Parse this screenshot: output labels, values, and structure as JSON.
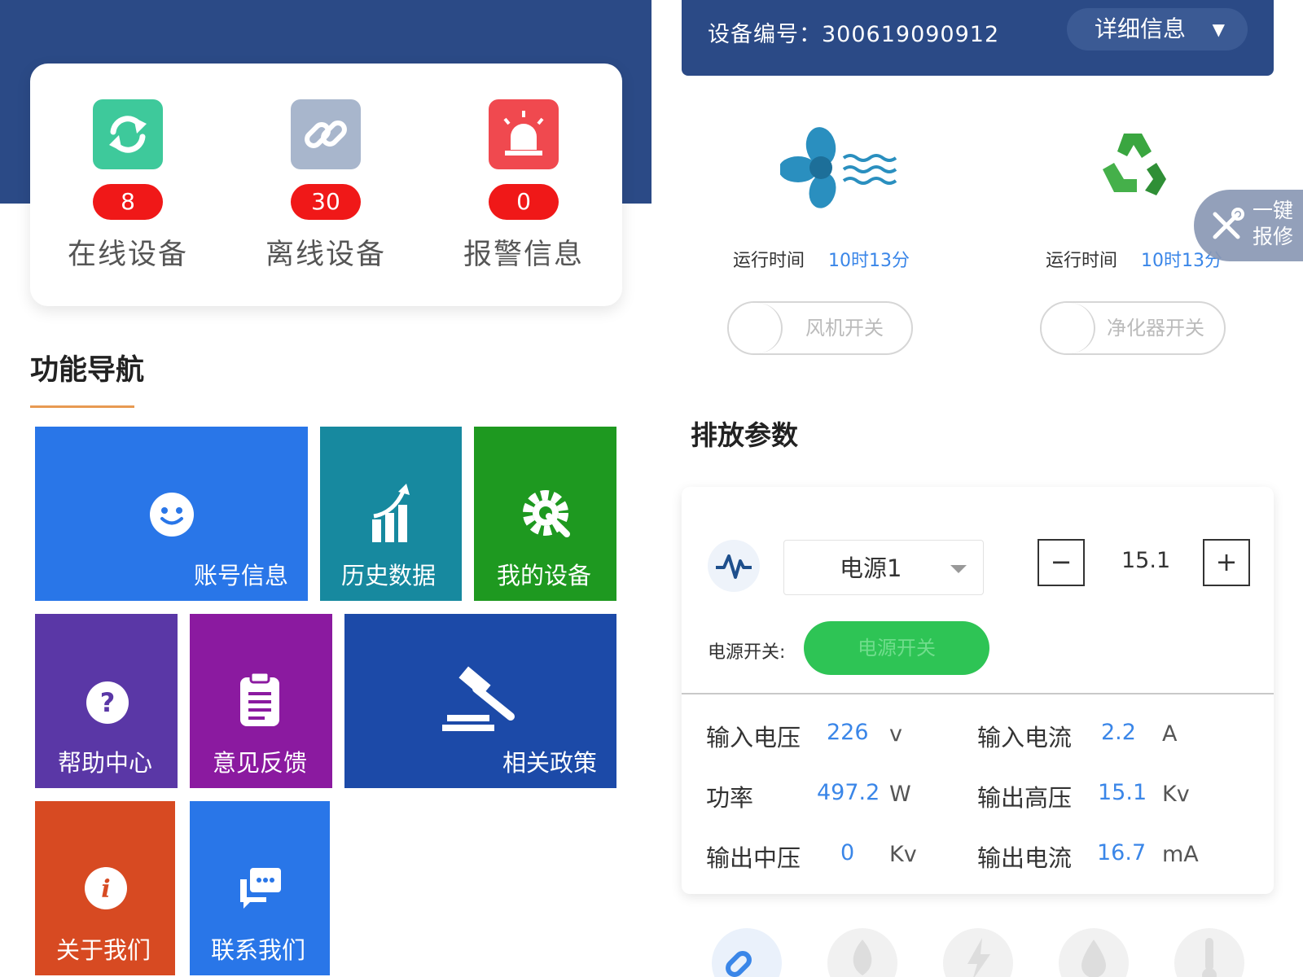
{
  "left": {
    "stats": [
      {
        "count": "8",
        "label": "在线设备",
        "icon": "refresh-icon",
        "color": "#3ec99b"
      },
      {
        "count": "30",
        "label": "离线设备",
        "icon": "link-icon",
        "color": "#a8b6cc"
      },
      {
        "count": "0",
        "label": "报警信息",
        "icon": "alarm-light-icon",
        "color": "#f0494f"
      }
    ],
    "nav_title": "功能导航",
    "tiles": [
      {
        "label": "账号信息",
        "icon": "smiley-icon",
        "color": "#2976e8"
      },
      {
        "label": "历史数据",
        "icon": "bar-chart-icon",
        "color": "#17899f"
      },
      {
        "label": "我的设备",
        "icon": "gear-wrench-icon",
        "color": "#1e9920"
      },
      {
        "label": "帮助中心",
        "icon": "question-icon",
        "color": "#5a37a6"
      },
      {
        "label": "意见反馈",
        "icon": "clipboard-icon",
        "color": "#8b1aa0"
      },
      {
        "label": "相关政策",
        "icon": "gavel-icon",
        "color": "#1c4aa8"
      },
      {
        "label": "关于我们",
        "icon": "info-icon",
        "color": "#d74a22"
      },
      {
        "label": "联系我们",
        "icon": "chat-icon",
        "color": "#2976e8"
      }
    ]
  },
  "right": {
    "device_id": "设备编号：300619090912",
    "detail_label": "详细信息",
    "units": [
      {
        "icon": "fan-icon",
        "run_label": "运行时间",
        "run_value": "10时13分",
        "switch_label": "风机开关"
      },
      {
        "icon": "recycle-icon",
        "run_label": "运行时间",
        "run_value": "10时13分",
        "switch_label": "净化器开关"
      }
    ],
    "repair_label": "一键报修",
    "section_title": "排放参数",
    "source_selected": "电源1",
    "minus_label": "−",
    "plus_label": "+",
    "setpoint": "15.1",
    "power_switch_label": "电源开关:",
    "power_switch_button": "电源开关",
    "metrics": [
      {
        "name": "输入电压",
        "value": "226",
        "unit": "v"
      },
      {
        "name": "输入电流",
        "value": "2.2",
        "unit": "A"
      },
      {
        "name": "功率",
        "value": "497.2",
        "unit": "W"
      },
      {
        "name": "输出高压",
        "value": "15.1",
        "unit": "Kv"
      },
      {
        "name": "输出中压",
        "value": "0",
        "unit": "Kv"
      },
      {
        "name": "输出电流",
        "value": "16.7",
        "unit": "mA"
      }
    ],
    "bottom_icons": [
      "link-icon",
      "flame-icon",
      "lightning-icon",
      "drop-icon",
      "thermometer-icon"
    ]
  }
}
